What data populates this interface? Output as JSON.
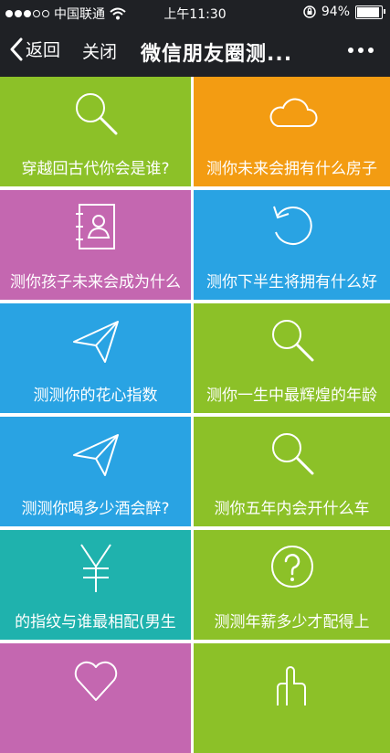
{
  "status": {
    "carrier": "中国联通",
    "time": "上午11:30",
    "battery": "94%",
    "battery_level": 0.94
  },
  "nav": {
    "back": "返回",
    "close": "关闭",
    "title": "微信朋友圈测..."
  },
  "colors": {
    "green": "#8cc128",
    "orange": "#f39c12",
    "pink": "#c467b0",
    "blue": "#29a3e3",
    "teal": "#1fb2ad",
    "status_bar": "#1f2125"
  },
  "tiles": [
    {
      "label": "穿越回古代你会是谁?",
      "icon": "search-icon",
      "color": "green"
    },
    {
      "label": "测你未来会拥有什么房子",
      "icon": "cloud-icon",
      "color": "orange"
    },
    {
      "label": "测你孩子未来会成为什么",
      "icon": "contact-card-icon",
      "color": "pink"
    },
    {
      "label": "测你下半生将拥有什么好",
      "icon": "refresh-icon",
      "color": "blue"
    },
    {
      "label": "测测你的花心指数",
      "icon": "paper-plane-icon",
      "color": "blue"
    },
    {
      "label": "测你一生中最辉煌的年龄",
      "icon": "search-icon",
      "color": "green"
    },
    {
      "label": "测测你喝多少酒会醉?",
      "icon": "paper-plane-icon",
      "color": "blue"
    },
    {
      "label": "测你五年内会开什么车",
      "icon": "search-icon",
      "color": "green"
    },
    {
      "label": "的指纹与谁最相配(男生",
      "icon": "yen-icon",
      "color": "teal"
    },
    {
      "label": "测测年薪多少才配得上",
      "icon": "question-icon",
      "color": "green"
    },
    {
      "label": "",
      "icon": "heart-icon",
      "color": "pink"
    },
    {
      "label": "",
      "icon": "hand-pointer-icon",
      "color": "green"
    }
  ]
}
